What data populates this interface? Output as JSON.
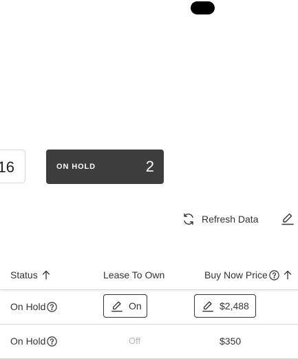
{
  "stats": {
    "partial_count": "16",
    "on_hold": {
      "label": "ON HOLD",
      "count": "2"
    }
  },
  "toolbar": {
    "refresh_label": "Refresh Data"
  },
  "table": {
    "columns": {
      "status": "Status",
      "lease_to_own": "Lease To Own",
      "buy_now_price": "Buy Now Price"
    },
    "rows": [
      {
        "status": "On Hold",
        "lease_to_own": "On",
        "buy_now_price": "$2,488"
      },
      {
        "status": "On Hold",
        "lease_to_own": "Off",
        "buy_now_price": "$350"
      }
    ]
  },
  "colors": {
    "card_dark": "#3d3d3d",
    "border": "#d4d4d4",
    "muted_text": "#b5b5b5"
  }
}
